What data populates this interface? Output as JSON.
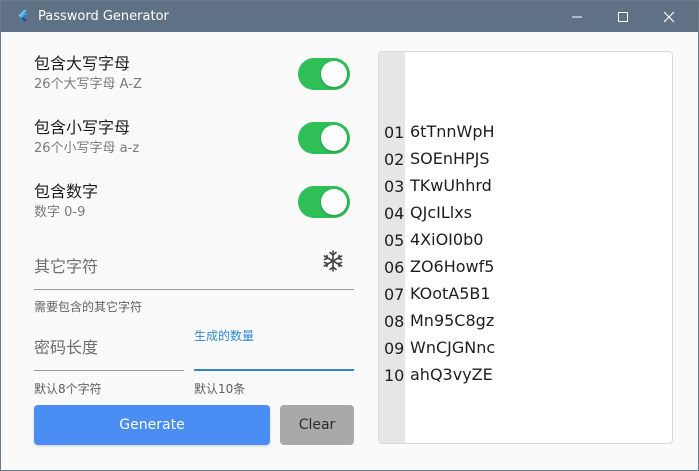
{
  "window": {
    "title": "Password Generator"
  },
  "options": [
    {
      "title": "包含大写字母",
      "subtitle": "26个大写字母 A-Z",
      "enabled": true
    },
    {
      "title": "包含小写字母",
      "subtitle": "26个小写字母 a-z",
      "enabled": true
    },
    {
      "title": "包含数字",
      "subtitle": "数字 0-9",
      "enabled": true
    }
  ],
  "other_chars": {
    "label": "其它字符",
    "helper": "需要包含的其它字符"
  },
  "length_field": {
    "label": "密码长度",
    "helper": "默认8个字符"
  },
  "count_field": {
    "label": "生成的数量",
    "helper": "默认10条"
  },
  "buttons": {
    "generate": "Generate",
    "clear": "Clear"
  },
  "output": {
    "lines": [
      {
        "num": "01",
        "password": "6tTnnWpH"
      },
      {
        "num": "02",
        "password": "SOEnHPJS"
      },
      {
        "num": "03",
        "password": "TKwUhhrd"
      },
      {
        "num": "04",
        "password": "QJcILlxs"
      },
      {
        "num": "05",
        "password": "4XiOI0b0"
      },
      {
        "num": "06",
        "password": "ZO6Howf5"
      },
      {
        "num": "07",
        "password": "KOotA5B1"
      },
      {
        "num": "08",
        "password": "Mn95C8gz"
      },
      {
        "num": "09",
        "password": "WnCJGNnc"
      },
      {
        "num": "10",
        "password": "ahQ3vyZE"
      }
    ]
  },
  "colors": {
    "titlebar": "#5f7185",
    "toggle_on": "#2fbf57",
    "primary": "#4a8ef3",
    "focus": "#2f86d6",
    "secondary_button": "#a9a9a9"
  }
}
